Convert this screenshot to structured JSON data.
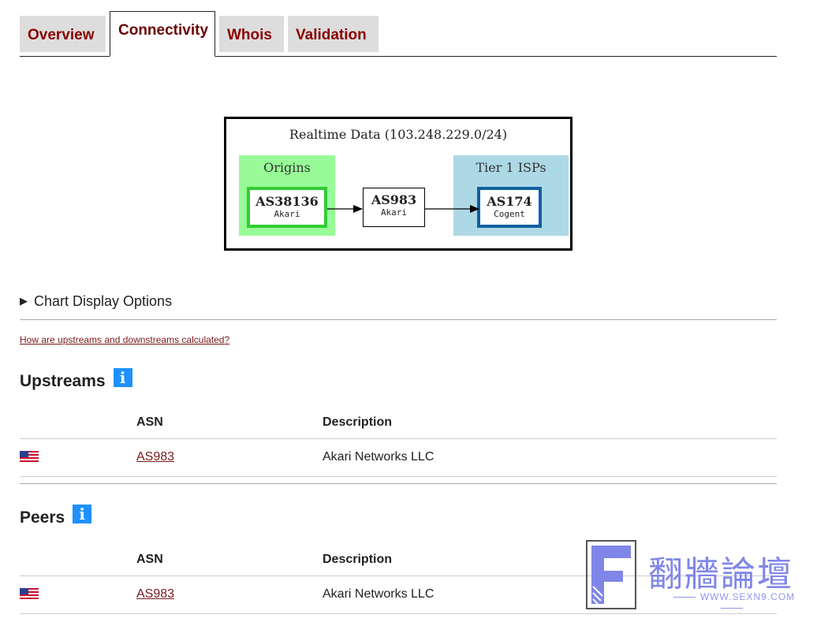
{
  "tabs": [
    {
      "label": "Overview",
      "active": false
    },
    {
      "label": "Connectivity",
      "active": true
    },
    {
      "label": "Whois",
      "active": false
    },
    {
      "label": "Validation",
      "active": false
    }
  ],
  "graph": {
    "title": "Realtime Data (103.248.229.0/24)",
    "clusters": {
      "origins": "Origins",
      "tier1": "Tier 1 ISPs"
    },
    "nodes": [
      {
        "asn": "AS38136",
        "org": "Akari"
      },
      {
        "asn": "AS983",
        "org": "Akari"
      },
      {
        "asn": "AS174",
        "org": "Cogent"
      }
    ],
    "colors": {
      "origins_fill": "#98fb98",
      "origins_border": "#33cc33",
      "tier1_fill": "#add8e6",
      "tier1_border": "#1060a0"
    }
  },
  "chart_options": {
    "label": "Chart Display Options",
    "icon": "disclosure-triangle-icon"
  },
  "help_link": "How are upstreams and downstreams calculated?",
  "upstreams": {
    "title": "Upstreams",
    "columns": {
      "asn": "ASN",
      "description": "Description"
    },
    "rows": [
      {
        "flag": "us-flag-icon",
        "asn": "AS983",
        "description": "Akari Networks LLC"
      }
    ]
  },
  "peers": {
    "title": "Peers",
    "columns": {
      "asn": "ASN",
      "description": "Description"
    },
    "rows": [
      {
        "flag": "us-flag-icon",
        "asn": "AS983",
        "description": "Akari Networks LLC"
      }
    ]
  },
  "watermark": {
    "text": "翻牆論壇",
    "url": "WWW.SEXN9.COM"
  },
  "colors": {
    "tab_text": "#8a0000",
    "link": "#7a1a1a",
    "info_icon": "#1e90ff"
  }
}
